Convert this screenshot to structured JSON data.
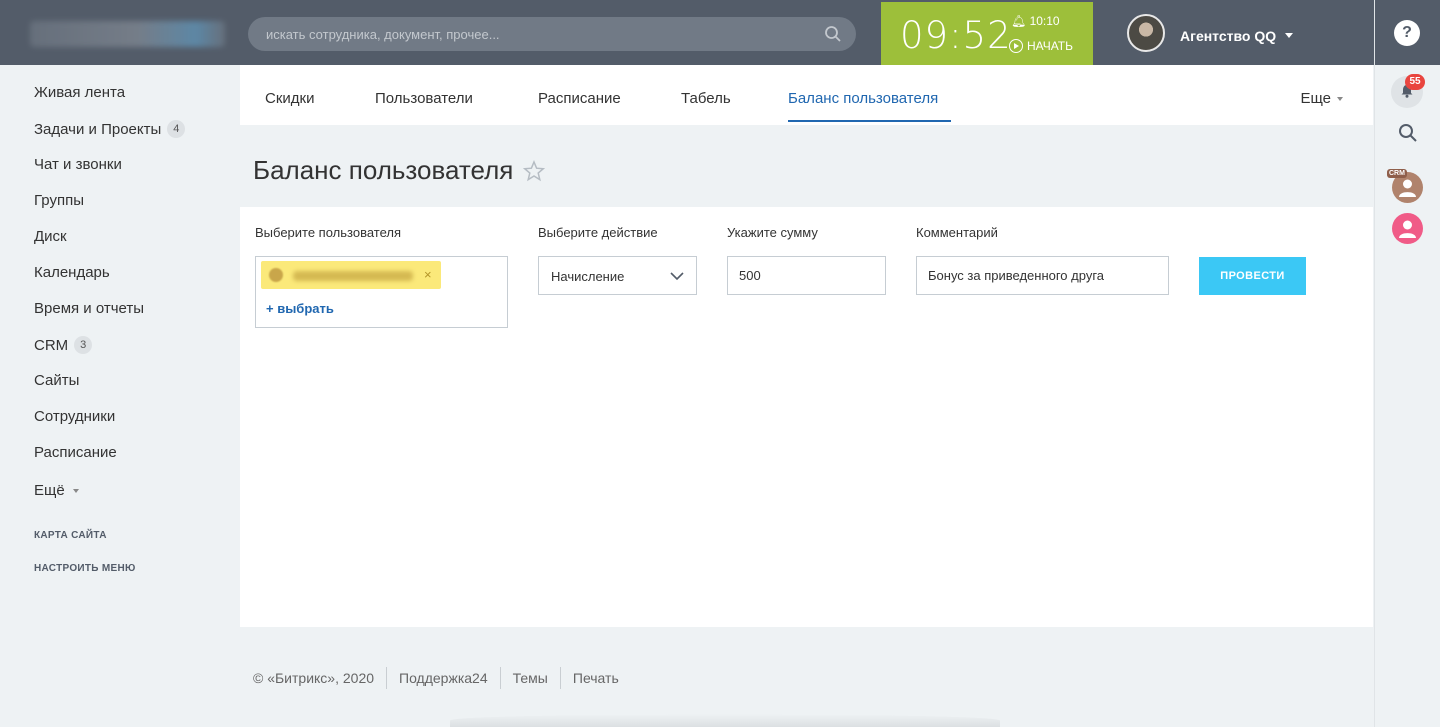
{
  "header": {
    "search_placeholder": "искать сотрудника, документ, прочее...",
    "clock_time": "09:52",
    "clock_alarm": "10:10",
    "clock_start": "НАЧАТЬ",
    "user_name": "Агентство QQ"
  },
  "rail": {
    "notifications_count": "55",
    "crm_label": "CRM",
    "help_glyph": "?"
  },
  "sidebar": {
    "items": [
      {
        "label": "Живая лента",
        "count": ""
      },
      {
        "label": "Задачи и Проекты",
        "count": "4"
      },
      {
        "label": "Чат и звонки",
        "count": ""
      },
      {
        "label": "Группы",
        "count": ""
      },
      {
        "label": "Диск",
        "count": ""
      },
      {
        "label": "Календарь",
        "count": ""
      },
      {
        "label": "Время и отчеты",
        "count": ""
      },
      {
        "label": "CRM",
        "count": "3"
      },
      {
        "label": "Сайты",
        "count": ""
      },
      {
        "label": "Сотрудники",
        "count": ""
      },
      {
        "label": "Расписание",
        "count": ""
      },
      {
        "label": "Ещё",
        "count": ""
      }
    ],
    "sitemap": "КАРТА САЙТА",
    "configure": "НАСТРОИТЬ МЕНЮ"
  },
  "tabs": {
    "items": [
      "Скидки",
      "Пользователи",
      "Расписание",
      "Табель",
      "Баланс пользователя"
    ],
    "more": "Еще"
  },
  "page": {
    "title": "Баланс пользователя"
  },
  "form": {
    "user_label": "Выберите пользователя",
    "add_user_link": "+ выбрать",
    "action_label": "Выберите действие",
    "action_value": "Начисление",
    "amount_label": "Укажите сумму",
    "amount_value": "500",
    "comment_label": "Комментарий",
    "comment_value": "Бонус за приведенного друга",
    "submit_label": "ПРОВЕСТИ"
  },
  "footer": {
    "copyright": "© «Битрикс», 2020",
    "support": "Поддержка24",
    "themes": "Темы",
    "print": "Печать"
  },
  "colors": {
    "header_bg": "#535c69",
    "clock_bg": "#9dbf3a",
    "accent_blue": "#2067b0",
    "button_bg": "#3bc8f5",
    "chip_bg": "#fbe97a",
    "badge_red": "#e9453f"
  }
}
